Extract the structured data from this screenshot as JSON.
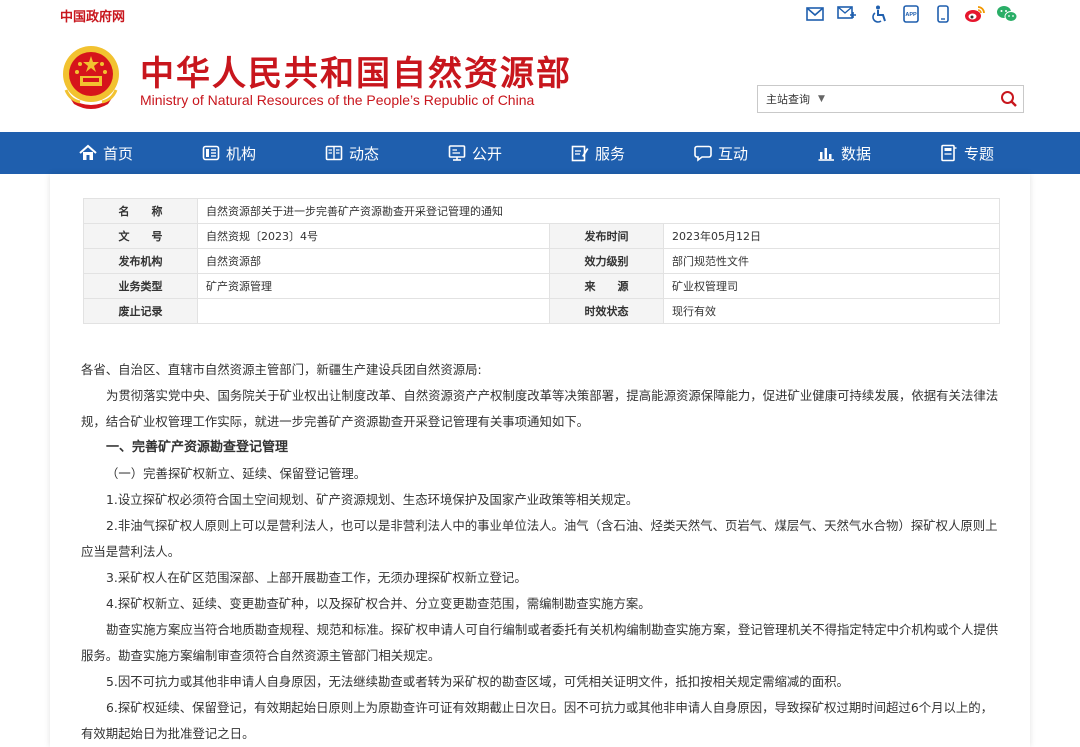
{
  "topbar": {
    "gov_link": "中国政府网",
    "icons": [
      "mail-icon",
      "message-icon",
      "accessibility-icon",
      "app-icon",
      "mobile-icon",
      "weibo-icon",
      "wechat-icon"
    ],
    "app_label": "APP"
  },
  "header": {
    "title_cn": "中华人民共和国自然资源部",
    "title_en": "Ministry of Natural Resources of the People’s Republic of China",
    "search": {
      "scope": "主站查询",
      "placeholder": "",
      "value": ""
    }
  },
  "nav": {
    "items": [
      {
        "label": "首页",
        "icon": "home-icon"
      },
      {
        "label": "机构",
        "icon": "org-icon"
      },
      {
        "label": "动态",
        "icon": "news-icon"
      },
      {
        "label": "公开",
        "icon": "monitor-icon"
      },
      {
        "label": "服务",
        "icon": "edit-icon"
      },
      {
        "label": "互动",
        "icon": "chat-icon"
      },
      {
        "label": "数据",
        "icon": "chart-icon"
      },
      {
        "label": "专题",
        "icon": "book-icon"
      }
    ]
  },
  "meta": {
    "name_label": "名　　称",
    "name_value": "自然资源部关于进一步完善矿产资源勘查开采登记管理的通知",
    "docno_label": "文　　号",
    "docno_value": "自然资规〔2023〕4号",
    "date_label": "发布时间",
    "date_value": "2023年05月12日",
    "org_label": "发布机构",
    "org_value": "自然资源部",
    "level_label": "效力级别",
    "level_value": "部门规范性文件",
    "type_label": "业务类型",
    "type_value": "矿产资源管理",
    "source_label": "来　　源",
    "source_value": "矿业权管理司",
    "abolish_label": "废止记录",
    "abolish_value": "",
    "status_label": "时效状态",
    "status_value": "现行有效"
  },
  "body": {
    "salutation": "各省、自治区、直辖市自然资源主管部门，新疆生产建设兵团自然资源局:",
    "intro": "为贯彻落实党中央、国务院关于矿业权出让制度改革、自然资源资产产权制度改革等决策部署，提高能源资源保障能力，促进矿业健康可持续发展，依据有关法律法规，结合矿业权管理工作实际，就进一步完善矿产资源勘查开采登记管理有关事项通知如下。",
    "section1": "一、完善矿产资源勘查登记管理",
    "sub1": "（一）完善探矿权新立、延续、保留登记管理。",
    "p1": "1.设立探矿权必须符合国土空间规划、矿产资源规划、生态环境保护及国家产业政策等相关规定。",
    "p2": "2.非油气探矿权人原则上可以是营利法人，也可以是非营利法人中的事业单位法人。油气（含石油、烃类天然气、页岩气、煤层气、天然气水合物）探矿权人原则上应当是营利法人。",
    "p3": "3.采矿权人在矿区范围深部、上部开展勘查工作，无须办理探矿权新立登记。",
    "p4": "4.探矿权新立、延续、变更勘查矿种，以及探矿权合并、分立变更勘查范围，需编制勘查实施方案。",
    "p4b": "勘查实施方案应当符合地质勘查规程、规范和标准。探矿权申请人可自行编制或者委托有关机构编制勘查实施方案，登记管理机关不得指定特定中介机构或个人提供服务。勘查实施方案编制审查须符合自然资源主管部门相关规定。",
    "p5": "5.因不可抗力或其他非申请人自身原因，无法继续勘查或者转为采矿权的勘查区域，可凭相关证明文件，抵扣按相关规定需缩减的面积。",
    "p6": "6.探矿权延续、保留登记，有效期起始日原则上为原勘查许可证有效期截止日次日。因不可抗力或其他非申请人自身原因，导致探矿权过期时间超过6个月以上的，有效期起始日为批准登记之日。"
  }
}
